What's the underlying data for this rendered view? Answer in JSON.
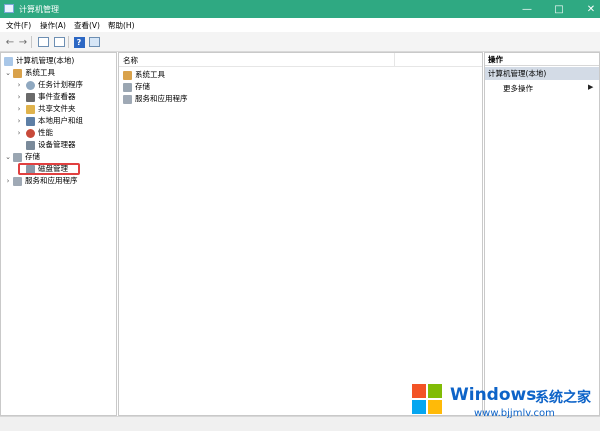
{
  "window": {
    "title": "计算机管理"
  },
  "menu": [
    "文件(F)",
    "操作(A)",
    "查看(V)",
    "帮助(H)"
  ],
  "toolbar": {
    "back": "←",
    "forward": "→"
  },
  "tree": {
    "root": "计算机管理(本地)",
    "system_tools": "系统工具",
    "items_system": [
      "任务计划程序",
      "事件查看器",
      "共享文件夹",
      "本地用户和组",
      "性能",
      "设备管理器"
    ],
    "storage": "存储",
    "disk_mgmt": "磁盘管理",
    "services": "服务和应用程序"
  },
  "center": {
    "column_name": "名称",
    "rows": [
      "系统工具",
      "存储",
      "服务和应用程序"
    ]
  },
  "actions": {
    "title": "操作",
    "selected": "计算机管理(本地)",
    "more": "更多操作",
    "arrow": "▶"
  },
  "watermark": {
    "brand": "Windows",
    "subtitle": "系统之家",
    "url": "www.bjjmlv.com"
  },
  "colors": {
    "titlebar": "#2fa982",
    "highlight_border": "#e14040",
    "selected_action_bg": "#d3dbe6",
    "watermark_blue": "#0d63c8"
  }
}
